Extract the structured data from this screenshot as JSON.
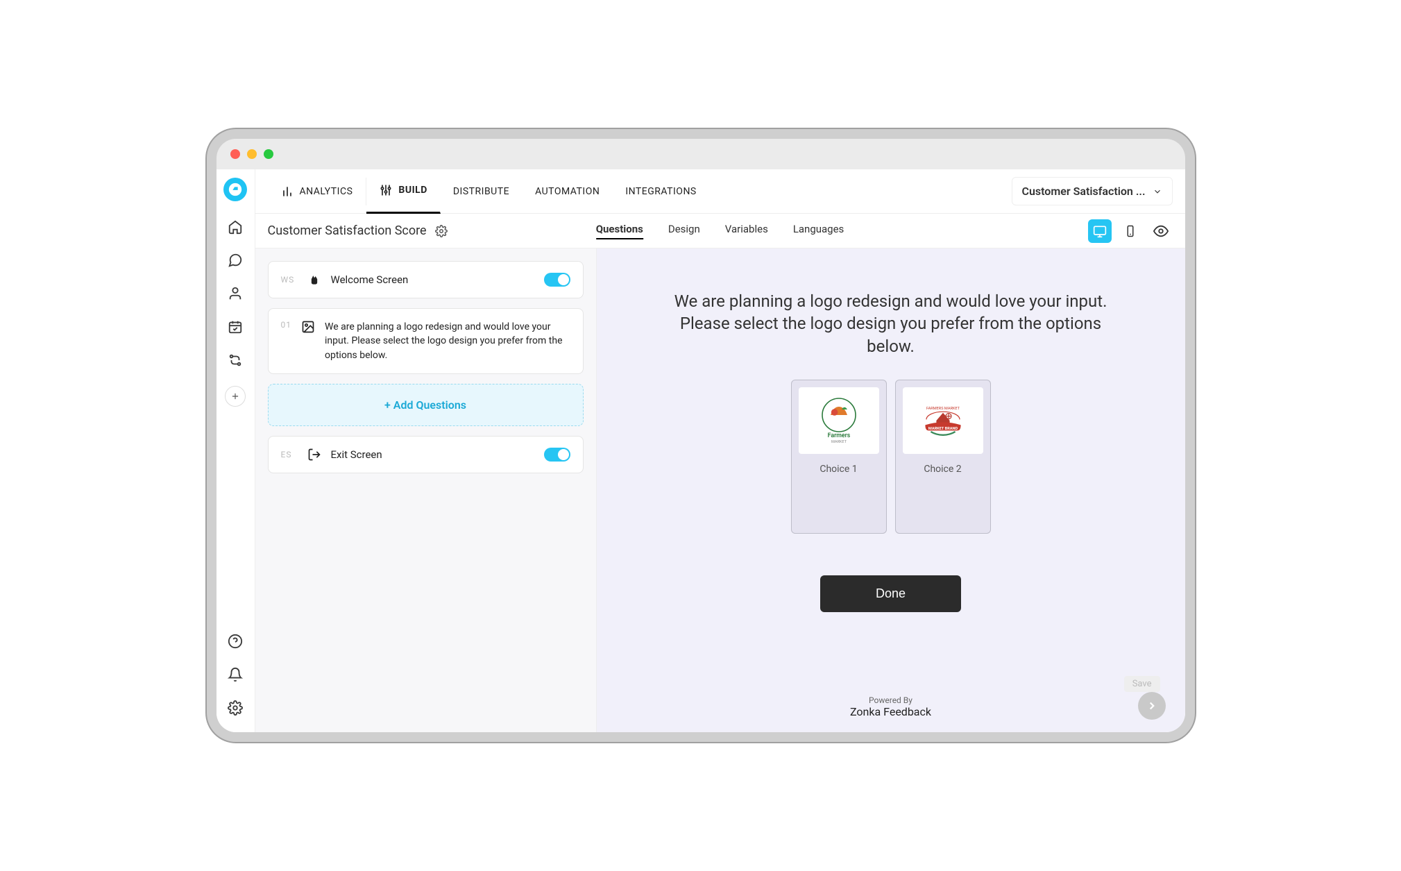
{
  "nav": {
    "analytics": "ANALYTICS",
    "build": "BUILD",
    "distribute": "DISTRIBUTE",
    "automation": "AUTOMATION",
    "integrations": "INTEGRATIONS",
    "survey_selector": "Customer Satisfaction ..."
  },
  "subbar": {
    "title": "Customer Satisfaction Score",
    "tabs": {
      "questions": "Questions",
      "design": "Design",
      "variables": "Variables",
      "languages": "Languages"
    }
  },
  "panel": {
    "welcome": {
      "code": "WS",
      "label": "Welcome Screen"
    },
    "q1": {
      "code": "01",
      "text": "We are planning a logo redesign and would love your input. Please select the logo design you prefer from the options below."
    },
    "add": "+ Add Questions",
    "exit": {
      "code": "ES",
      "label": "Exit Screen"
    }
  },
  "preview": {
    "question": "We are planning a logo redesign and would love your input. Please select the logo design you prefer from the options below.",
    "choices": [
      {
        "label": "Choice 1",
        "img_name": "farmers-market-green-logo"
      },
      {
        "label": "Choice 2",
        "img_name": "farmers-market-red-barn-logo"
      }
    ],
    "done": "Done",
    "save": "Save",
    "powered_top": "Powered By",
    "powered_brand": "Zonka Feedback"
  }
}
